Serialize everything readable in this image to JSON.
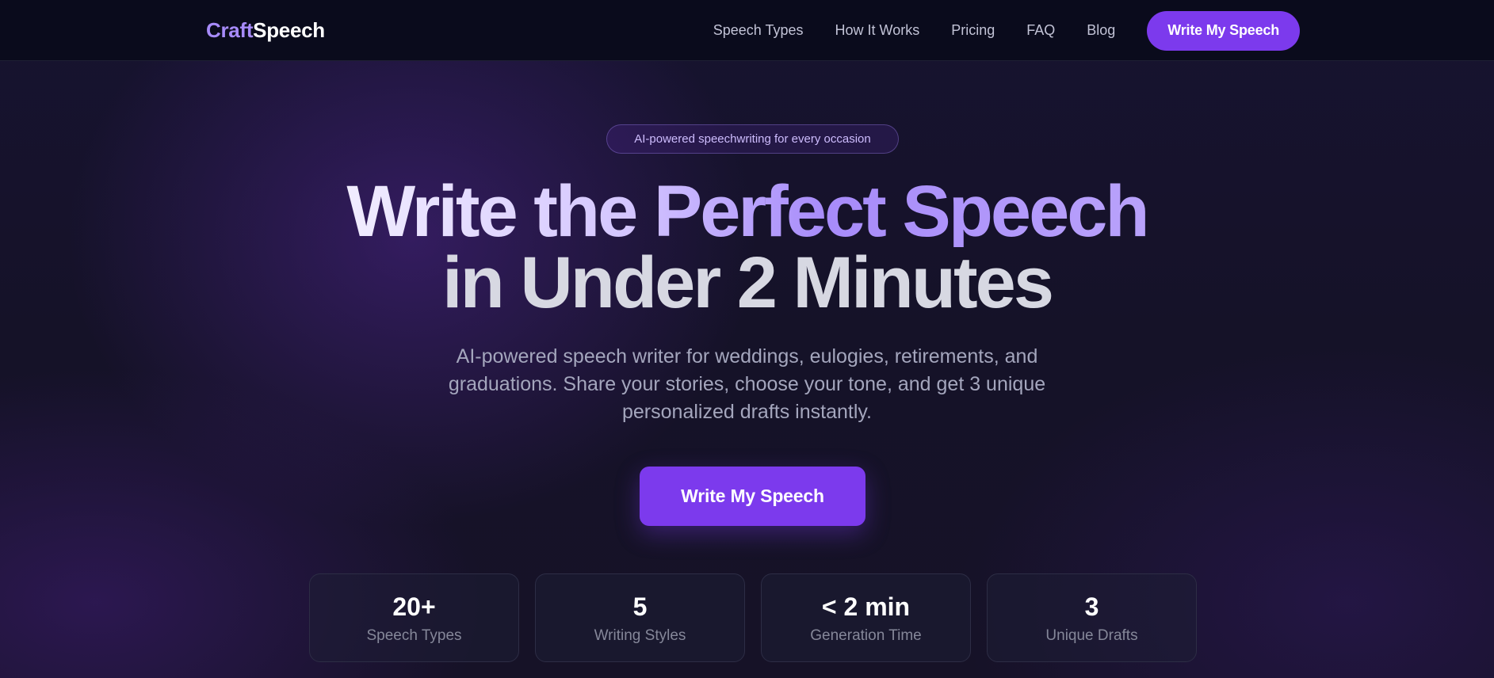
{
  "nav": {
    "logo_part1": "Craft",
    "logo_part2": "Speech",
    "links": [
      "Speech Types",
      "How It Works",
      "Pricing",
      "FAQ",
      "Blog"
    ],
    "cta_label": "Write My Speech"
  },
  "hero": {
    "badge": "AI-powered speechwriting for every occasion",
    "headline_line1": "Write the Perfect Speech",
    "headline_line2": "in Under 2 Minutes",
    "subtitle": "AI-powered speech writer for weddings, eulogies, retirements, and graduations. Share your stories, choose your tone, and get 3 unique personalized drafts instantly.",
    "cta_label": "Write My Speech"
  },
  "stats": [
    {
      "value": "20+",
      "label": "Speech Types"
    },
    {
      "value": "5",
      "label": "Writing Styles"
    },
    {
      "value": "< 2 min",
      "label": "Generation Time"
    },
    {
      "value": "3",
      "label": "Unique Drafts"
    }
  ],
  "colors": {
    "accent": "#7c3aed",
    "accent_light": "#a78bfa",
    "nav_bg": "#0a0b1c"
  }
}
